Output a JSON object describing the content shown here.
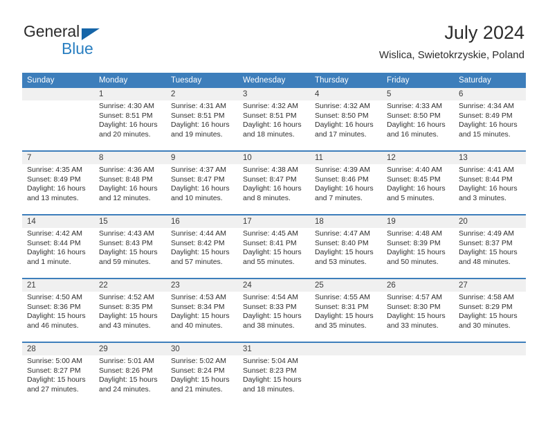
{
  "branding": {
    "name_dark": "General",
    "name_blue": "Blue",
    "triangle_color": "#1565a8",
    "blue_color": "#2a7fc1"
  },
  "header": {
    "title": "July 2024",
    "location": "Wislica, Swietokrzyskie, Poland"
  },
  "theme": {
    "header_bg": "#3d7ebb",
    "daynum_bg": "#f0f0f0",
    "text": "#2e2e2e"
  },
  "weekday_headers": [
    "Sunday",
    "Monday",
    "Tuesday",
    "Wednesday",
    "Thursday",
    "Friday",
    "Saturday"
  ],
  "weeks": [
    {
      "days": [
        {
          "day": "",
          "sunrise": "",
          "sunset": "",
          "daylight": "",
          "empty": true
        },
        {
          "day": "1",
          "sunrise": "Sunrise: 4:30 AM",
          "sunset": "Sunset: 8:51 PM",
          "daylight": "Daylight: 16 hours and 20 minutes."
        },
        {
          "day": "2",
          "sunrise": "Sunrise: 4:31 AM",
          "sunset": "Sunset: 8:51 PM",
          "daylight": "Daylight: 16 hours and 19 minutes."
        },
        {
          "day": "3",
          "sunrise": "Sunrise: 4:32 AM",
          "sunset": "Sunset: 8:51 PM",
          "daylight": "Daylight: 16 hours and 18 minutes."
        },
        {
          "day": "4",
          "sunrise": "Sunrise: 4:32 AM",
          "sunset": "Sunset: 8:50 PM",
          "daylight": "Daylight: 16 hours and 17 minutes."
        },
        {
          "day": "5",
          "sunrise": "Sunrise: 4:33 AM",
          "sunset": "Sunset: 8:50 PM",
          "daylight": "Daylight: 16 hours and 16 minutes."
        },
        {
          "day": "6",
          "sunrise": "Sunrise: 4:34 AM",
          "sunset": "Sunset: 8:49 PM",
          "daylight": "Daylight: 16 hours and 15 minutes."
        }
      ]
    },
    {
      "days": [
        {
          "day": "7",
          "sunrise": "Sunrise: 4:35 AM",
          "sunset": "Sunset: 8:49 PM",
          "daylight": "Daylight: 16 hours and 13 minutes."
        },
        {
          "day": "8",
          "sunrise": "Sunrise: 4:36 AM",
          "sunset": "Sunset: 8:48 PM",
          "daylight": "Daylight: 16 hours and 12 minutes."
        },
        {
          "day": "9",
          "sunrise": "Sunrise: 4:37 AM",
          "sunset": "Sunset: 8:47 PM",
          "daylight": "Daylight: 16 hours and 10 minutes."
        },
        {
          "day": "10",
          "sunrise": "Sunrise: 4:38 AM",
          "sunset": "Sunset: 8:47 PM",
          "daylight": "Daylight: 16 hours and 8 minutes."
        },
        {
          "day": "11",
          "sunrise": "Sunrise: 4:39 AM",
          "sunset": "Sunset: 8:46 PM",
          "daylight": "Daylight: 16 hours and 7 minutes."
        },
        {
          "day": "12",
          "sunrise": "Sunrise: 4:40 AM",
          "sunset": "Sunset: 8:45 PM",
          "daylight": "Daylight: 16 hours and 5 minutes."
        },
        {
          "day": "13",
          "sunrise": "Sunrise: 4:41 AM",
          "sunset": "Sunset: 8:44 PM",
          "daylight": "Daylight: 16 hours and 3 minutes."
        }
      ]
    },
    {
      "days": [
        {
          "day": "14",
          "sunrise": "Sunrise: 4:42 AM",
          "sunset": "Sunset: 8:44 PM",
          "daylight": "Daylight: 16 hours and 1 minute."
        },
        {
          "day": "15",
          "sunrise": "Sunrise: 4:43 AM",
          "sunset": "Sunset: 8:43 PM",
          "daylight": "Daylight: 15 hours and 59 minutes."
        },
        {
          "day": "16",
          "sunrise": "Sunrise: 4:44 AM",
          "sunset": "Sunset: 8:42 PM",
          "daylight": "Daylight: 15 hours and 57 minutes."
        },
        {
          "day": "17",
          "sunrise": "Sunrise: 4:45 AM",
          "sunset": "Sunset: 8:41 PM",
          "daylight": "Daylight: 15 hours and 55 minutes."
        },
        {
          "day": "18",
          "sunrise": "Sunrise: 4:47 AM",
          "sunset": "Sunset: 8:40 PM",
          "daylight": "Daylight: 15 hours and 53 minutes."
        },
        {
          "day": "19",
          "sunrise": "Sunrise: 4:48 AM",
          "sunset": "Sunset: 8:39 PM",
          "daylight": "Daylight: 15 hours and 50 minutes."
        },
        {
          "day": "20",
          "sunrise": "Sunrise: 4:49 AM",
          "sunset": "Sunset: 8:37 PM",
          "daylight": "Daylight: 15 hours and 48 minutes."
        }
      ]
    },
    {
      "days": [
        {
          "day": "21",
          "sunrise": "Sunrise: 4:50 AM",
          "sunset": "Sunset: 8:36 PM",
          "daylight": "Daylight: 15 hours and 46 minutes."
        },
        {
          "day": "22",
          "sunrise": "Sunrise: 4:52 AM",
          "sunset": "Sunset: 8:35 PM",
          "daylight": "Daylight: 15 hours and 43 minutes."
        },
        {
          "day": "23",
          "sunrise": "Sunrise: 4:53 AM",
          "sunset": "Sunset: 8:34 PM",
          "daylight": "Daylight: 15 hours and 40 minutes."
        },
        {
          "day": "24",
          "sunrise": "Sunrise: 4:54 AM",
          "sunset": "Sunset: 8:33 PM",
          "daylight": "Daylight: 15 hours and 38 minutes."
        },
        {
          "day": "25",
          "sunrise": "Sunrise: 4:55 AM",
          "sunset": "Sunset: 8:31 PM",
          "daylight": "Daylight: 15 hours and 35 minutes."
        },
        {
          "day": "26",
          "sunrise": "Sunrise: 4:57 AM",
          "sunset": "Sunset: 8:30 PM",
          "daylight": "Daylight: 15 hours and 33 minutes."
        },
        {
          "day": "27",
          "sunrise": "Sunrise: 4:58 AM",
          "sunset": "Sunset: 8:29 PM",
          "daylight": "Daylight: 15 hours and 30 minutes."
        }
      ]
    },
    {
      "days": [
        {
          "day": "28",
          "sunrise": "Sunrise: 5:00 AM",
          "sunset": "Sunset: 8:27 PM",
          "daylight": "Daylight: 15 hours and 27 minutes."
        },
        {
          "day": "29",
          "sunrise": "Sunrise: 5:01 AM",
          "sunset": "Sunset: 8:26 PM",
          "daylight": "Daylight: 15 hours and 24 minutes."
        },
        {
          "day": "30",
          "sunrise": "Sunrise: 5:02 AM",
          "sunset": "Sunset: 8:24 PM",
          "daylight": "Daylight: 15 hours and 21 minutes."
        },
        {
          "day": "31",
          "sunrise": "Sunrise: 5:04 AM",
          "sunset": "Sunset: 8:23 PM",
          "daylight": "Daylight: 15 hours and 18 minutes."
        },
        {
          "day": "",
          "sunrise": "",
          "sunset": "",
          "daylight": "",
          "empty": true
        },
        {
          "day": "",
          "sunrise": "",
          "sunset": "",
          "daylight": "",
          "empty": true
        },
        {
          "day": "",
          "sunrise": "",
          "sunset": "",
          "daylight": "",
          "empty": true
        }
      ]
    }
  ]
}
